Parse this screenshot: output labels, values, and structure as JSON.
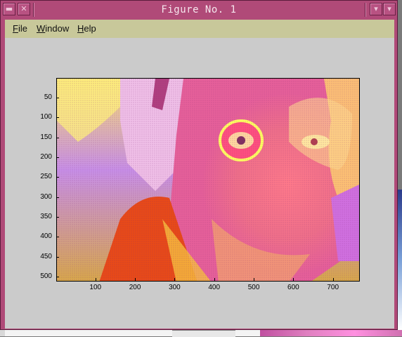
{
  "window": {
    "title": "Figure No. 1",
    "buttons": [
      "▾",
      "▾"
    ]
  },
  "menu": {
    "items": [
      {
        "label": "File",
        "ul": "F",
        "rest": "ile"
      },
      {
        "label": "Window",
        "ul": "W",
        "rest": "indow"
      },
      {
        "label": "Help",
        "ul": "H",
        "rest": "elp"
      }
    ]
  },
  "axes": {
    "image_description_icon": "image-display",
    "yticks": [
      "50",
      "100",
      "150",
      "200",
      "250",
      "300",
      "350",
      "400",
      "450",
      "500"
    ],
    "xticks": [
      "100",
      "200",
      "300",
      "400",
      "500",
      "600",
      "700"
    ],
    "x_range": [
      1,
      768
    ],
    "y_range": [
      1,
      512
    ]
  },
  "colors": {
    "title_bar": "#b04a78",
    "menu_bar": "#c8c89a",
    "figure_bg": "#cbcbcb"
  }
}
